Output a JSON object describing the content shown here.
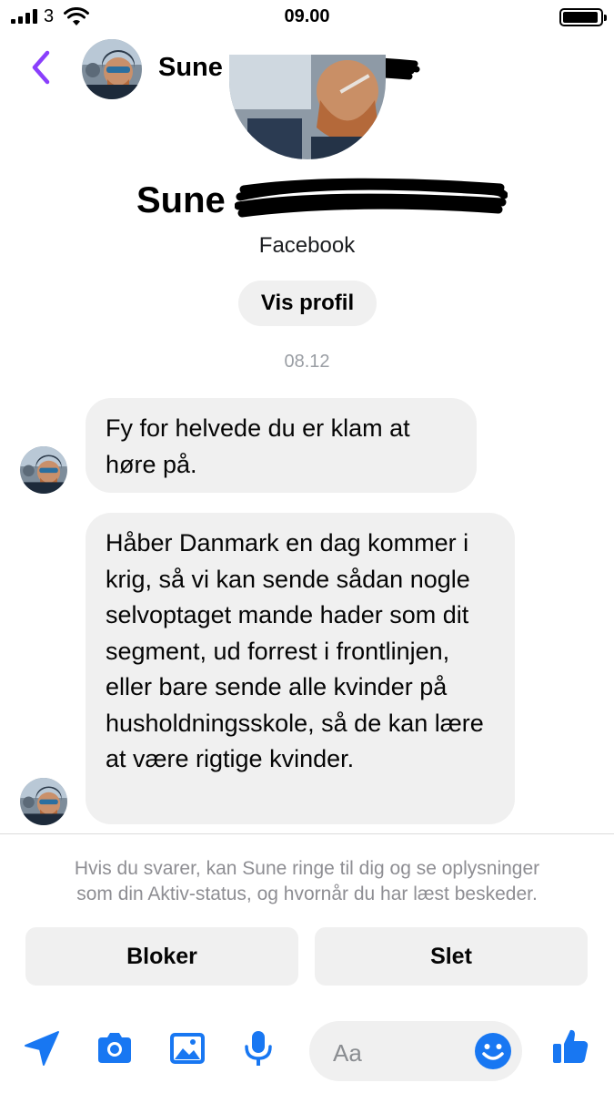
{
  "status_bar": {
    "carrier": "3",
    "time": "09.00"
  },
  "header": {
    "name": "Sune"
  },
  "profile": {
    "name": "Sune",
    "source": "Facebook",
    "view_profile_label": "Vis profil"
  },
  "conversation": {
    "date_separator": "08.12",
    "messages": [
      {
        "text": "Fy for helvede du er klam at høre på."
      },
      {
        "text": "Håber Danmark en dag kommer i krig, så vi kan sende sådan nogle selvoptaget mande hader som dit segment, ud forrest i frontlinjen, eller bare sende alle kvinder på husholdningsskole, så de kan lære at være rigtige kvinder."
      }
    ]
  },
  "notice": {
    "line1": "Hvis du svarer, kan Sune ringe til dig og se oplysninger",
    "line2": "som din Aktiv-status, og hvornår du har læst beskeder."
  },
  "actions": {
    "block_label": "Bloker",
    "delete_label": "Slet"
  },
  "composer": {
    "placeholder": "Aa"
  },
  "icons": {
    "back": "chevron-left-icon",
    "send": "location-arrow-icon",
    "camera": "camera-icon",
    "gallery": "image-icon",
    "voice": "microphone-icon",
    "emoji": "emoji-icon",
    "like": "thumbs-up-icon"
  },
  "colors": {
    "accent": "#8a3ffc",
    "messenger_blue": "#1877f2",
    "bubble_gray": "#f0f0f0",
    "muted_text": "#8e8e93"
  }
}
